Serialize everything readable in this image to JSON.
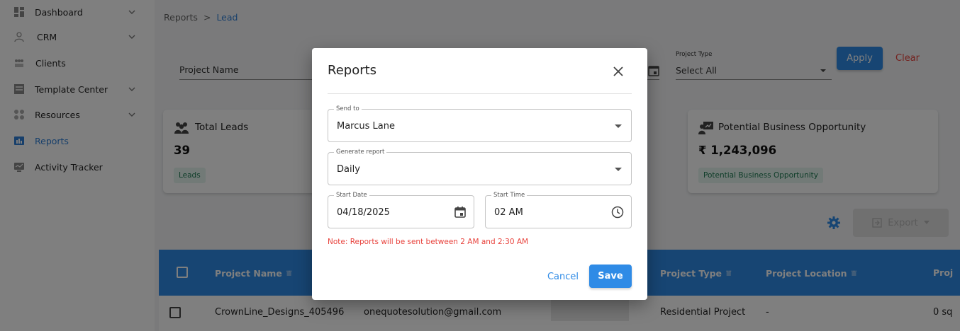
{
  "sidebar": {
    "items": [
      {
        "label": "Dashboard",
        "icon": "dashboard-icon",
        "has_chevron": true
      },
      {
        "label": "CRM",
        "icon": "crm-icon",
        "has_chevron": true
      },
      {
        "label": "Clients",
        "icon": "clients-icon",
        "has_chevron": false
      },
      {
        "label": "Template Center",
        "icon": "template-icon",
        "has_chevron": true
      },
      {
        "label": "Resources",
        "icon": "resources-icon",
        "has_chevron": true
      },
      {
        "label": "Reports",
        "icon": "reports-icon",
        "has_chevron": false,
        "active": true
      },
      {
        "label": "Activity Tracker",
        "icon": "activity-tracker-icon",
        "has_chevron": false
      }
    ]
  },
  "breadcrumb": {
    "parent": "Reports",
    "separator": ">",
    "current": "Lead"
  },
  "filters": {
    "project_name_label": "Project Name",
    "project_type_label": "Project Type",
    "project_type_value": "Select All",
    "apply_label": "Apply",
    "clear_label": "Clear"
  },
  "cards": [
    {
      "title": "Total Leads",
      "value": "39",
      "chip": "Leads"
    },
    {
      "title": "Potential Business Opportunity",
      "value": "₹ 1,243,096",
      "chip": "Potential Business Opportunity"
    }
  ],
  "toolbar": {
    "export_label": "Export"
  },
  "table": {
    "headers": [
      "Project Name",
      "Project Type",
      "Project Location",
      "Proj"
    ],
    "rows": [
      {
        "project_name": "CrownLine_Designs_405496",
        "email": "onequotesolution@gmail.com",
        "project_type": "Residential Project",
        "location": "-",
        "extra": "0 sq"
      }
    ]
  },
  "modal": {
    "title": "Reports",
    "send_to_label": "Send to",
    "send_to_value": "Marcus Lane",
    "generate_label": "Generate report",
    "generate_value": "Daily",
    "start_date_label": "Start Date",
    "start_date_value": "04/18/2025",
    "start_time_label": "Start Time",
    "start_time_value": "02 AM",
    "note": "Note: Reports will be sent between 2 AM and 2:30 AM",
    "cancel_label": "Cancel",
    "save_label": "Save"
  },
  "colors": {
    "accent": "#2f8be6",
    "danger": "#e8433d",
    "chip_bg": "#e4f5ee",
    "chip_text": "#1e7a52"
  }
}
